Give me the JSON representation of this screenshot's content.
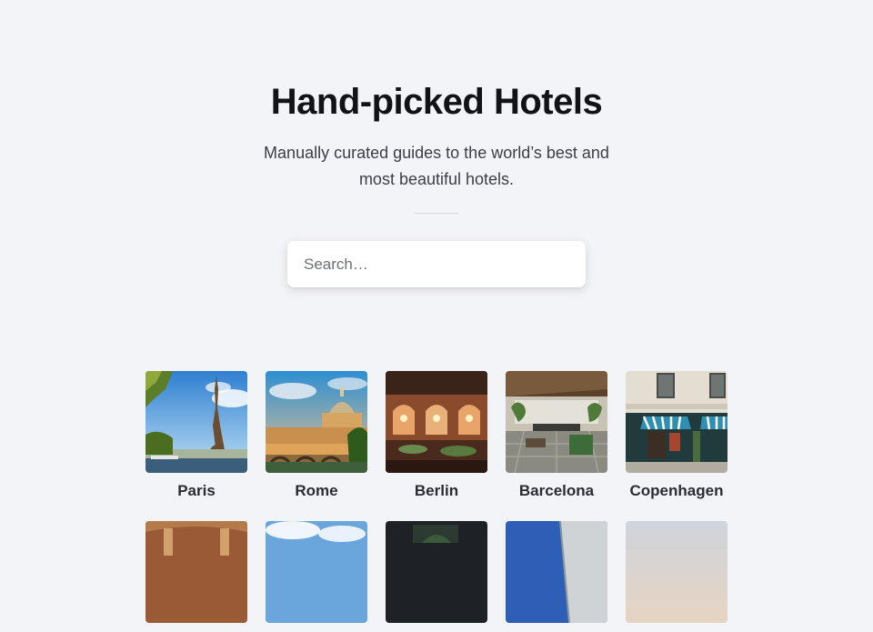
{
  "header": {
    "title": "Hand-picked Hotels",
    "subtitle": "Manually curated guides to the world’s best and most beautiful hotels."
  },
  "search": {
    "placeholder": "Search…"
  },
  "cities": [
    {
      "name": "Paris",
      "image": "eiffel-tower-photo"
    },
    {
      "name": "Rome",
      "image": "st-peters-basilica-photo"
    },
    {
      "name": "Berlin",
      "image": "restaurant-interior-photo"
    },
    {
      "name": "Barcelona",
      "image": "rooftop-terrace-photo"
    },
    {
      "name": "Copenhagen",
      "image": "cafe-facade-photo"
    },
    {
      "name": "",
      "image": "interior-warm-photo"
    },
    {
      "name": "",
      "image": "sky-photo"
    },
    {
      "name": "",
      "image": "dark-interior-photo"
    },
    {
      "name": "",
      "image": "building-blue-photo"
    },
    {
      "name": "",
      "image": "facade-light-photo"
    }
  ]
}
